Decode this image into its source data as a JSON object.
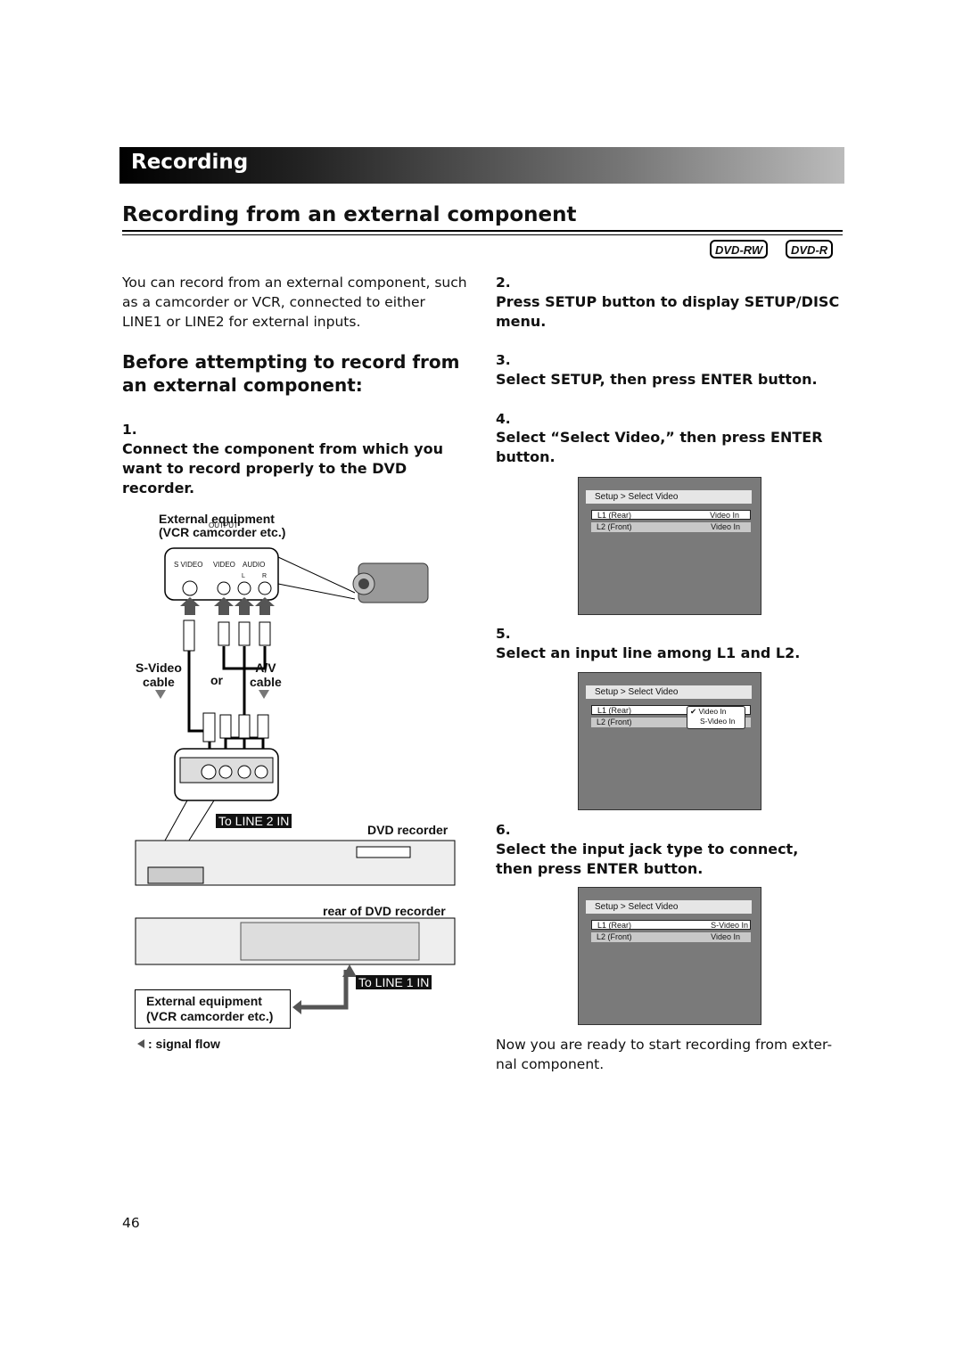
{
  "header": {
    "section": "Recording"
  },
  "title": "Recording from an external component",
  "badges": [
    "DVD-RW",
    "DVD-R"
  ],
  "intro": "You can record from an external component, such as a camcorder or VCR, connected to either LINE1 or LINE2 for external inputs.",
  "subheading": "Before attempting to record from an external component:",
  "steps": [
    {
      "num": "1.",
      "text": "Connect the component from which you want to record properly to the DVD recorder."
    },
    {
      "num": "2.",
      "text": "Press SETUP button to display SETUP/DISC menu."
    },
    {
      "num": "3.",
      "text": "Select SETUP, then press ENTER button."
    },
    {
      "num": "4.",
      "text": "Select “Select Video,” then press ENTER button."
    },
    {
      "num": "5.",
      "text": "Select an input line among L1 and L2."
    },
    {
      "num": "6.",
      "text": "Select the input jack type to connect, then press ENTER button."
    }
  ],
  "diagram": {
    "ext_equipment": "External equipment",
    "ext_equipment2": "(VCR camcorder etc.)",
    "output": "OUTPUT",
    "svideo": "S VIDEO",
    "video": "VIDEO",
    "audio": "AUDIO",
    "l": "L",
    "r": "R",
    "svideo_cable": "S-Video",
    "cable": "cable",
    "or": "or",
    "av": "A/V",
    "av_cable": "cable",
    "to_line2": "To LINE 2 IN",
    "dvd_recorder": "DVD recorder",
    "rear": "rear of DVD recorder",
    "to_line1": "To LINE 1 IN",
    "legend": ": signal flow"
  },
  "screens": [
    {
      "header": "Setup > Select Video",
      "rows": [
        {
          "label": "L1 (Rear)",
          "value": "Video In"
        },
        {
          "label": "L2 (Front)",
          "value": "Video In"
        }
      ]
    },
    {
      "header": "Setup > Select Video",
      "rows": [
        {
          "label": "L1 (Rear)",
          "value": ""
        },
        {
          "label": "L2 (Front)",
          "value": ""
        }
      ],
      "popup": [
        "Video In",
        "S-Video In"
      ]
    },
    {
      "header": "Setup > Select Video",
      "rows": [
        {
          "label": "L1 (Rear)",
          "value": "S-Video In"
        },
        {
          "label": "L2 (Front)",
          "value": "Video In"
        }
      ]
    }
  ],
  "outro": "Now you are ready to start recording from exter- nal component.",
  "page_number": "46"
}
